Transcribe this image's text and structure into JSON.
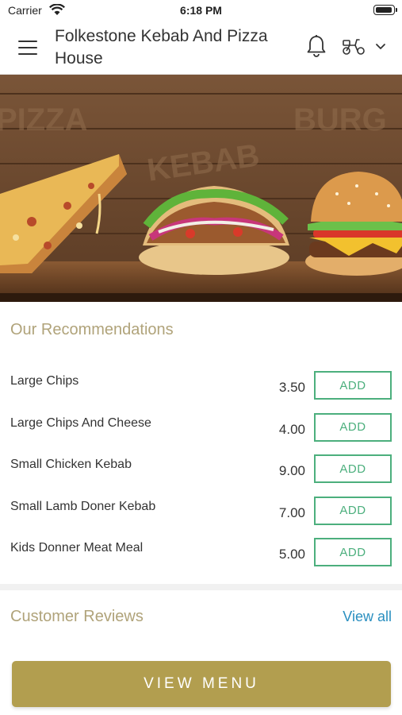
{
  "status_bar": {
    "carrier": "Carrier",
    "time": "6:18 PM"
  },
  "header": {
    "title": "Folkestone Kebab And Pizza House",
    "icons": [
      "menu-icon",
      "bell-icon",
      "scooter-icon",
      "chevron-down-icon"
    ]
  },
  "banner": {
    "wall_text": [
      "PIZZA",
      "KEBAB",
      "BURG"
    ]
  },
  "recommendations": {
    "title": "Our Recommendations",
    "add_label": "ADD",
    "items": [
      {
        "name": "Large Chips",
        "price": "3.50"
      },
      {
        "name": "Large Chips And Cheese",
        "price": "4.00"
      },
      {
        "name": "Small Chicken Kebab",
        "price": "9.00"
      },
      {
        "name": "Small Lamb Doner Kebab",
        "price": "7.00"
      },
      {
        "name": "Kids Donner Meat Meal",
        "price": "5.00"
      }
    ]
  },
  "reviews": {
    "title": "Customer Reviews",
    "view_all": "View all"
  },
  "cta": {
    "label": "VIEW MENU"
  },
  "colors": {
    "accent_gold": "#b29e4f",
    "title_tan": "#b0a37a",
    "add_green": "#4caf7d",
    "link_blue": "#2a8fc0"
  }
}
